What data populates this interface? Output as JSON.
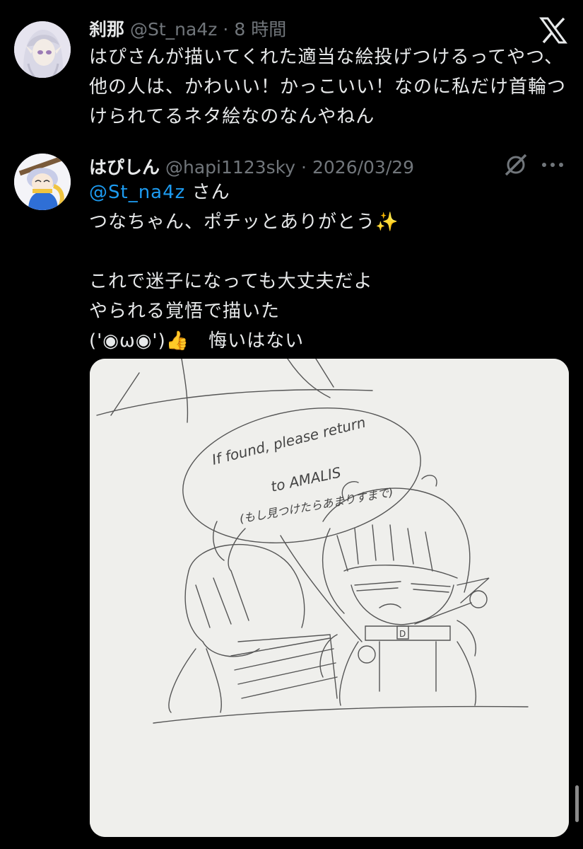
{
  "post1": {
    "display_name": "刹那",
    "handle": "@St_na4z",
    "separator": "·",
    "time": "8 時間",
    "text": "はぴさんが描いてくれた適当な絵投げつけるってやつ、他の人は、かわいい！かっこいい！なのに私だけ首輪つけられてるネタ絵なのなんやねん",
    "icon": "x-logo-icon"
  },
  "post2": {
    "display_name": "はぴしん",
    "handle": "@hapi1123sky",
    "separator": "·",
    "date": "2026/03/29",
    "mention": "@St_na4z",
    "mention_suffix": " さん",
    "line1": "つなちゃん、ポチッとありがとう",
    "line1_emoji": "✨",
    "line3": "これで迷子になっても大丈夫だよ",
    "line4": "やられる覚悟で描いた",
    "line5_prefix": "('◉ω◉')",
    "line5_emoji": "👍",
    "line5_suffix": "　悔いはない",
    "icons": [
      "grok-slash-icon",
      "more-dots-icon"
    ]
  },
  "drawing": {
    "bubble_line1": "If found, please return",
    "bubble_line2": "to AMALIS",
    "bubble_line3": "(もし見つけたらあまりすまで)",
    "tag_letter": "D"
  },
  "colors": {
    "background": "#000000",
    "text": "#e7e9ea",
    "muted": "#71767b",
    "link": "#1d9bf0"
  }
}
